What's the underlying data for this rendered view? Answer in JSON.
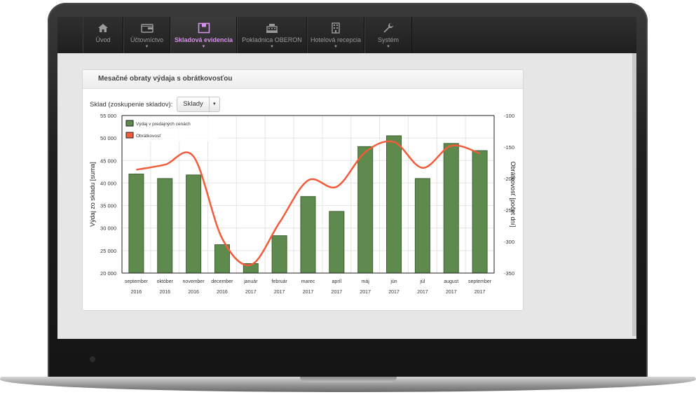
{
  "nav": {
    "items": [
      {
        "label": "Úvod",
        "icon": "home-icon",
        "caret": false,
        "active": false
      },
      {
        "label": "Účtovníctvo",
        "icon": "wallet-icon",
        "caret": true,
        "active": false
      },
      {
        "label": "Skladová evidencia",
        "icon": "warehouse-box-icon",
        "caret": true,
        "active": true
      },
      {
        "label": "Pokladnica OBERON",
        "icon": "cash-register-icon",
        "caret": true,
        "active": false
      },
      {
        "label": "Hotelová recepcia",
        "icon": "hotel-building-icon",
        "caret": true,
        "active": false
      },
      {
        "label": "Systém",
        "icon": "wrench-icon",
        "caret": true,
        "active": false
      }
    ]
  },
  "panel": {
    "title": "Mesačné obraty výdaja s obrátkovosťou",
    "filter_label": "Sklad (zoskupenie skladov):",
    "filter_value": "Sklady"
  },
  "colors": {
    "bars": "#5f8a4d",
    "bar_stroke": "#3d5f30",
    "line": "#f25c3a",
    "active_nav": "#d590e8"
  },
  "chart_data": {
    "type": "bar",
    "categories": [
      "september 2016",
      "október 2016",
      "november 2016",
      "december 2016",
      "január 2017",
      "február 2017",
      "marec 2017",
      "apríl 2017",
      "máj 2017",
      "jún 2017",
      "júl 2017",
      "august 2017",
      "september 2017"
    ],
    "category_lines": [
      [
        "september",
        "2016"
      ],
      [
        "október",
        "2016"
      ],
      [
        "november",
        "2016"
      ],
      [
        "december",
        "2016"
      ],
      [
        "január",
        "2017"
      ],
      [
        "február",
        "2017"
      ],
      [
        "marec",
        "2017"
      ],
      [
        "apríl",
        "2017"
      ],
      [
        "máj",
        "2017"
      ],
      [
        "jún",
        "2017"
      ],
      [
        "júl",
        "2017"
      ],
      [
        "august",
        "2017"
      ],
      [
        "september",
        "2017"
      ]
    ],
    "series": [
      {
        "name": "Výdaj v predajných cenách",
        "type": "bar",
        "axis": "left",
        "values": [
          42000,
          41000,
          41800,
          26300,
          22100,
          28300,
          37000,
          33700,
          48100,
          50500,
          41000,
          48800,
          47200
        ]
      },
      {
        "name": "Obrátkovosť",
        "type": "line",
        "axis": "right",
        "values": [
          -186,
          -178,
          -165,
          -295,
          -337,
          -270,
          -203,
          -213,
          -158,
          -142,
          -183,
          -148,
          -160
        ]
      }
    ],
    "ylabel": "Výdaj zo skladu [suma]",
    "ylabel_right": "Obrátkovosť [počet dní]",
    "ylim": [
      20000,
      55000
    ],
    "yticks": [
      "20 000",
      "25 000",
      "30 000",
      "35 000",
      "40 000",
      "45 000",
      "50 000",
      "55 000"
    ],
    "ylim_right": [
      -350,
      -100
    ],
    "yticks_right": [
      "-350",
      "-300",
      "-250",
      "-200",
      "-150",
      "-100"
    ],
    "grid": true,
    "legend_placement": "top-left"
  }
}
